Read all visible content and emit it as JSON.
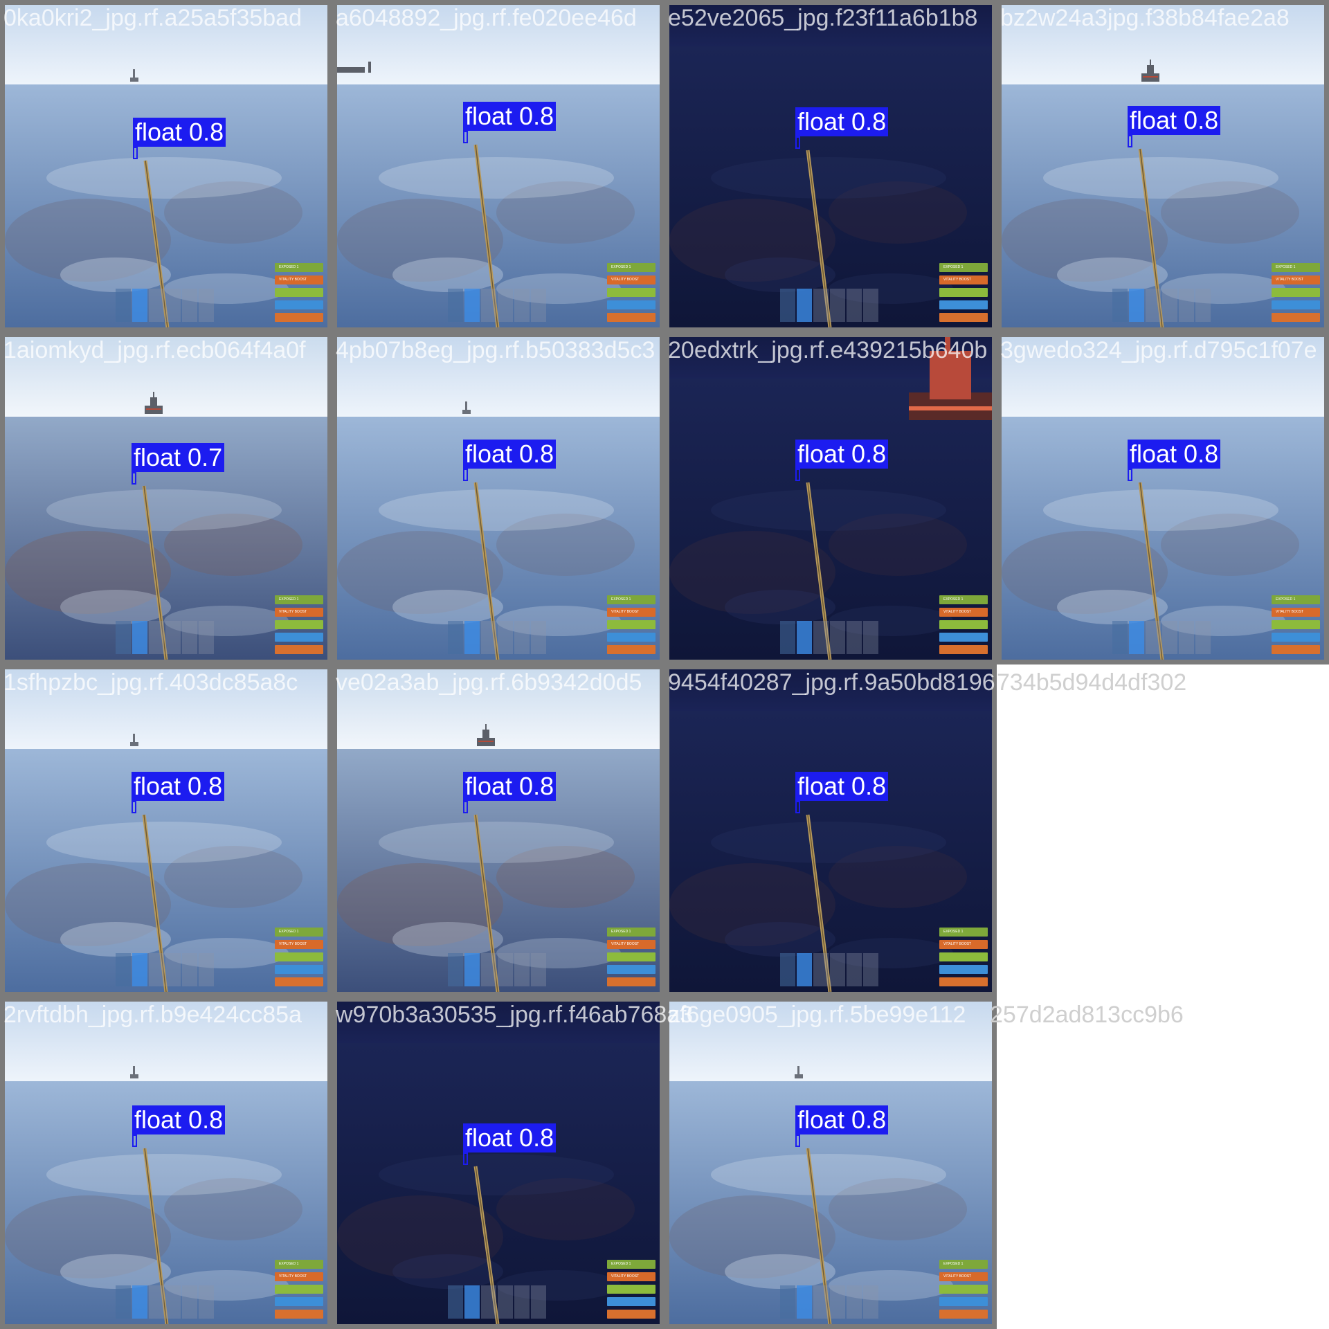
{
  "mosaic": {
    "tiles": [
      {
        "filename": "0ka0kri2_jpg.rf.a25a5f35bad",
        "label": "float 0.8",
        "tone": "day",
        "ship": "tower"
      },
      {
        "filename": "a6048892_jpg.rf.fe020ee46d",
        "label": "float 0.8",
        "tone": "day",
        "ship": "tower2"
      },
      {
        "filename": "e52ve2065_jpg.f23f11a6b1b8",
        "label": "float 0.8",
        "tone": "night",
        "ship": ""
      },
      {
        "filename": "bz2w24a3jpg.f38b84fae2a8",
        "label": "float 0.8",
        "tone": "day",
        "ship": "tanker"
      },
      {
        "filename": "1aiomkyd_jpg.rf.ecb064f4a0f",
        "label": "float 0.7",
        "tone": "dusk",
        "ship": "tanker"
      },
      {
        "filename": "4pb07b8eg_jpg.rf.b50383d5c3",
        "label": "float 0.8",
        "tone": "day",
        "ship": "tower"
      },
      {
        "filename": "20edxtrk_jpg.rf.e439215b640b",
        "label": "float 0.8",
        "tone": "night",
        "ship": "cargo"
      },
      {
        "filename": "3gwedo324_jpg.rf.d795c1f07e",
        "label": "float 0.8",
        "tone": "day",
        "ship": ""
      },
      {
        "filename": "1sfhpzbc_jpg.rf.403dc85a8c",
        "label": "float 0.8",
        "tone": "day",
        "ship": "tower"
      },
      {
        "filename": "ve02a3ab_jpg.rf.6b9342d0d5",
        "label": "float 0.8",
        "tone": "dusk",
        "ship": "tanker"
      },
      {
        "filename": "9454f40287_jpg.rf.9a50bd8196",
        "label": "float 0.8",
        "tone": "night",
        "ship": ""
      },
      {
        "filename": "2rvftdbh_jpg.rf.b9e424cc85a",
        "label": "float 0.8",
        "tone": "day",
        "ship": "tower"
      },
      {
        "filename": "w970b3a30535_jpg.rf.f46ab768a3",
        "label": "float 0.8",
        "tone": "night",
        "ship": ""
      },
      {
        "filename": "zf6ge0905_jpg.rf.5be99e112",
        "label": "float 0.8",
        "tone": "day",
        "ship": "tower"
      }
    ],
    "overflow_texts": [
      "734b5d94d4df302",
      "257d2ad813cc9b6"
    ]
  },
  "hud": {
    "bars": [
      {
        "text": "EXPOSED 1",
        "color": "#7ea83a"
      },
      {
        "text": "VITALITY BOOST",
        "color": "#d86a2a"
      },
      {
        "text": "",
        "color": "#8dbb3c"
      },
      {
        "text": "",
        "color": "#3d8fd8"
      },
      {
        "text": "",
        "color": "#d8702e"
      }
    ]
  },
  "colors": {
    "detection": "#1c1cf0",
    "frame": "#7b7b7b"
  }
}
